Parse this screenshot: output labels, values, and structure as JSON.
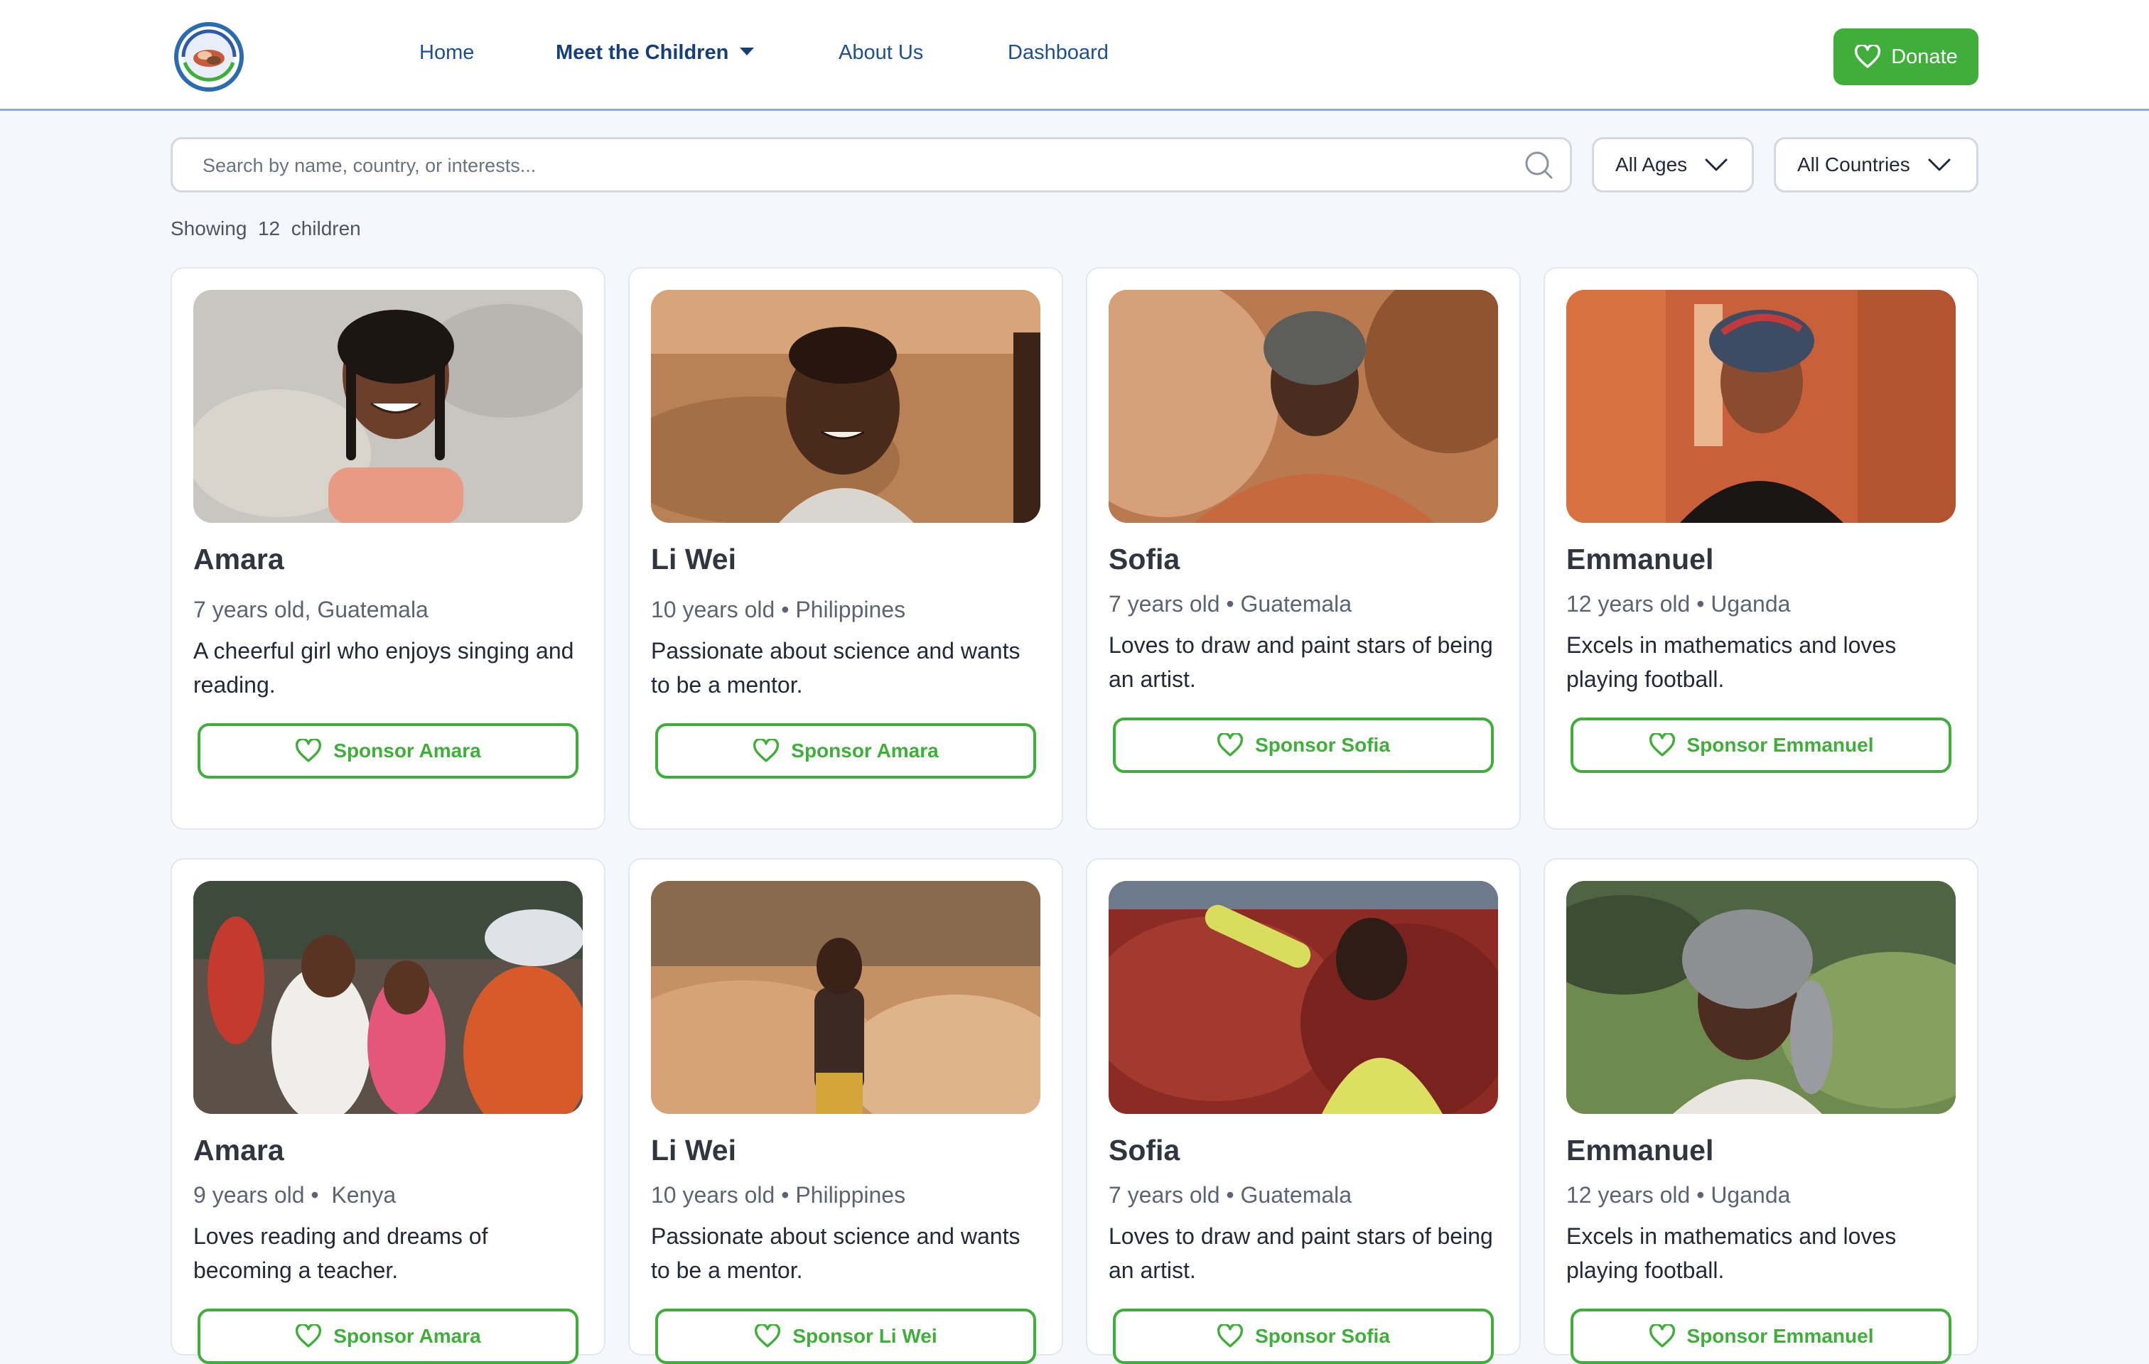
{
  "nav": {
    "logo_icon": "foundation-logo",
    "items": [
      "Home",
      "Meet the Children",
      "About Us",
      "Dashboard"
    ],
    "active": "Meet the Children",
    "donate_label": "Donate"
  },
  "filters": {
    "search_placeholder": "Search by name, country, or interests...",
    "age_label": "All Ages",
    "country_label": "All Countries"
  },
  "results": {
    "prefix": "Showing",
    "count": "12",
    "suffix": "children"
  },
  "children": [
    {
      "name": "Amara",
      "meta": "7 years old, Guatemala",
      "description": "A cheerful girl who enjoys singing and reading.",
      "button": "Sponsor Amara"
    },
    {
      "name": "Li Wei",
      "meta": "10 years old • Philippines",
      "description": "Passionate about science and wants to be a mentor.",
      "button": "Sponsor Amara"
    },
    {
      "name": "Sofia",
      "meta": "7 years old • Guatemala",
      "description": "Loves to draw and paint stars of being an artist.",
      "button": "Sponsor Sofia"
    },
    {
      "name": "Emmanuel",
      "meta": "12 years old • Uganda",
      "description": "Excels in mathematics and loves playing football.",
      "button": "Sponsor Emmanuel"
    },
    {
      "name": "Amara",
      "meta": "9 years old •  Kenya",
      "description": "Loves reading and dreams of becoming a teacher.",
      "button": "Sponsor Amara"
    },
    {
      "name": "Li Wei",
      "meta": "10 years old • Philippines",
      "description": "Passionate about science and wants to be a mentor.",
      "button": "Sponsor Li Wei"
    },
    {
      "name": "Sofia",
      "meta": "7 years old • Guatemala",
      "description": "Loves to draw and paint stars of being an artist.",
      "button": "Sponsor Sofia"
    },
    {
      "name": "Emmanuel",
      "meta": "12 years old • Uganda",
      "description": "Excels in mathematics and loves playing football.",
      "button": "Sponsor Emmanuel"
    }
  ],
  "colors": {
    "brand_green": "#3fae3a",
    "nav_blue": "#1d4f91",
    "background": "#f4f7fb"
  }
}
